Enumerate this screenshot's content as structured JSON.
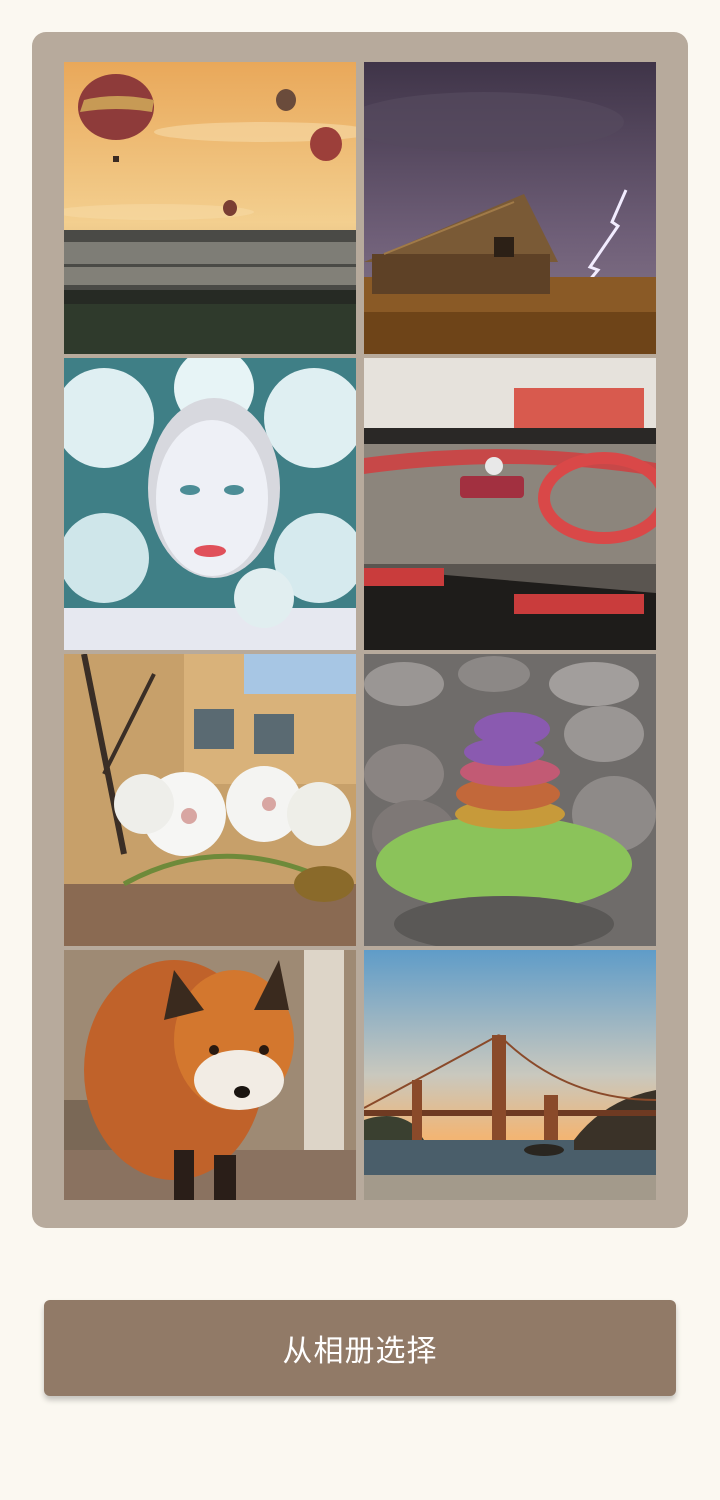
{
  "gallery": {
    "photos": [
      {
        "subject": "hot-air-balloons-over-misty-valley"
      },
      {
        "subject": "wooden-barn-with-lightning-storm"
      },
      {
        "subject": "woman-face-in-white-flowers"
      },
      {
        "subject": "go-kart-on-race-track"
      },
      {
        "subject": "white-blossoms-on-branch"
      },
      {
        "subject": "stacked-colorful-pebbles"
      },
      {
        "subject": "red-fox-in-forest"
      },
      {
        "subject": "golden-gate-bridge-at-sunset"
      }
    ]
  },
  "actions": {
    "select_from_album_label": "从相册选择"
  },
  "colors": {
    "page_background": "#fbf8f1",
    "card_background": "#b7aa9c",
    "button_background": "#917a67",
    "button_text": "#ffffff"
  }
}
